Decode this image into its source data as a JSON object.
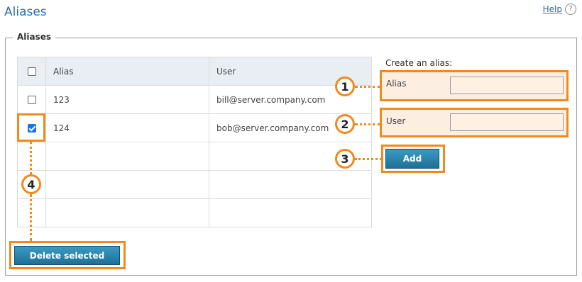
{
  "page": {
    "title": "Aliases"
  },
  "help": {
    "label": "Help",
    "icon": "question-circle-icon",
    "icon_glyph": "?"
  },
  "section": {
    "legend": "Aliases"
  },
  "table": {
    "headers": {
      "alias": "Alias",
      "user": "User"
    },
    "rows": [
      {
        "alias": "123",
        "user": "bill@server.company.com",
        "checked": false
      },
      {
        "alias": "124",
        "user": "bob@server.company.com",
        "checked": true
      },
      {
        "alias": "",
        "user": "",
        "checked": null
      },
      {
        "alias": "",
        "user": "",
        "checked": null
      },
      {
        "alias": "",
        "user": "",
        "checked": null
      }
    ]
  },
  "create": {
    "heading": "Create an alias:",
    "alias_label": "Alias",
    "alias_value": "",
    "user_label": "User",
    "user_value": "",
    "add_label": "Add"
  },
  "actions": {
    "delete_label": "Delete selected"
  },
  "callouts": {
    "one": "1",
    "two": "2",
    "three": "3",
    "four": "4"
  },
  "colors": {
    "highlight": "#f08a1e",
    "title": "#2a6fa8",
    "button": "#2a85b0",
    "field_bg": "#fdeee2"
  }
}
